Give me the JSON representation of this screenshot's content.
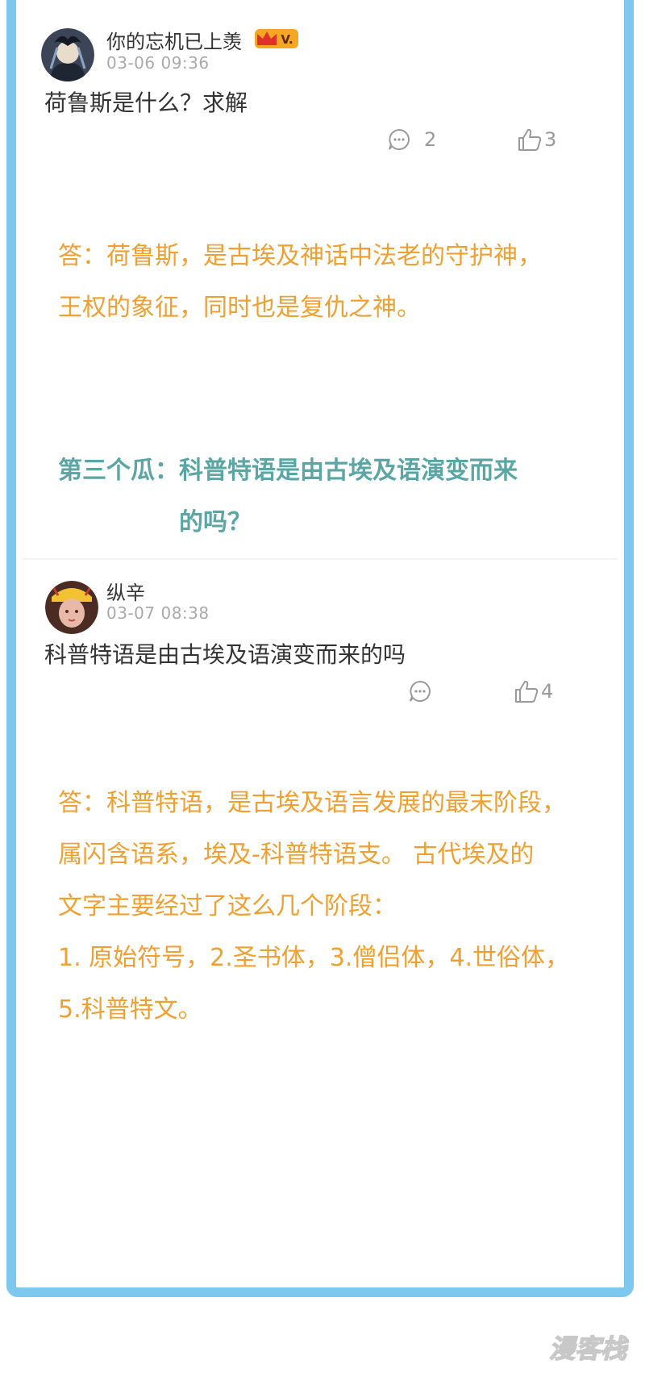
{
  "posts": [
    {
      "username": "你的忘机已上羡",
      "vip_label": "V.",
      "timestamp": "03-06 09:36",
      "text": "荷鲁斯是什么？求解",
      "comment_count": "2",
      "like_count": "3"
    },
    {
      "username": "纵辛",
      "timestamp": "03-07 08:38",
      "text": "科普特语是由古埃及语演变而来的吗",
      "like_count": "4"
    }
  ],
  "answer1": {
    "lines": [
      "答：荷鲁斯，是古埃及神话中法老的守护神，",
      "王权的象征，同时也是复仇之神。"
    ]
  },
  "section3": {
    "prefix": "第三个瓜：",
    "lines": [
      "科普特语是由古埃及语演变而来",
      "的吗？"
    ]
  },
  "answer2": {
    "lines": [
      "答：科普特语，是古埃及语言发展的最末阶段，",
      "属闪含语系，埃及-科普特语支。 古代埃及的",
      "文字主要经过了这么几个阶段：",
      "1. 原始符号，2.圣书体，3.僧侣体，4.世俗体，",
      "5.科普特文。"
    ]
  },
  "watermark": {
    "text": "漫客栈"
  },
  "colors": {
    "frame": "#7dc8ef",
    "answer": "#f0a030",
    "section_title": "#5aa6a4",
    "timestamp": "#aaaaaa"
  }
}
